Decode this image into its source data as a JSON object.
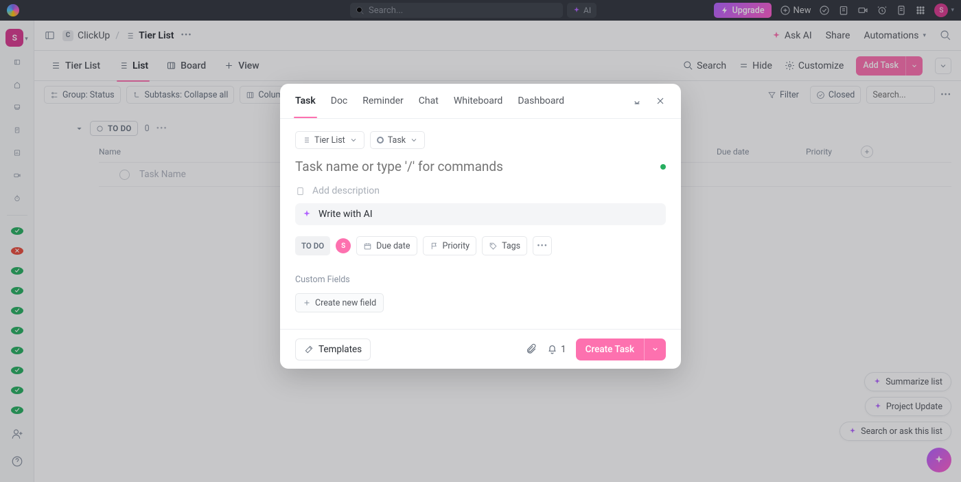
{
  "topbar": {
    "search_placeholder": "Search...",
    "ai_label": "AI",
    "upgrade_label": "Upgrade",
    "new_label": "New",
    "avatar_initial": "S"
  },
  "breadcrumb": {
    "workspace_initial": "C",
    "workspace_label": "ClickUp",
    "list_label": "Tier List",
    "ask_ai_label": "Ask AI",
    "share_label": "Share",
    "automations_label": "Automations"
  },
  "view_tabs": {
    "tier_list": "Tier List",
    "list": "List",
    "board": "Board",
    "view": "View",
    "search": "Search",
    "hide": "Hide",
    "customize": "Customize",
    "add_task": "Add Task"
  },
  "toolbar": {
    "group": "Group: Status",
    "subtasks": "Subtasks: Collapse all",
    "columns": "Columns",
    "filter": "Filter",
    "closed": "Closed",
    "search_placeholder": "Search..."
  },
  "group_header": {
    "status": "TO DO",
    "count": "0"
  },
  "columns": {
    "name": "Name",
    "due_date": "Due date",
    "priority": "Priority"
  },
  "task_row": {
    "placeholder": "Task Name"
  },
  "ai_pills": {
    "summarize": "Summarize list",
    "project_update": "Project Update",
    "search_ask": "Search or ask this list"
  },
  "sidebar": {
    "user_initial": "S"
  },
  "modal": {
    "tabs": {
      "task": "Task",
      "doc": "Doc",
      "reminder": "Reminder",
      "chat": "Chat",
      "whiteboard": "Whiteboard",
      "dashboard": "Dashboard"
    },
    "crumb_list": "Tier List",
    "crumb_type": "Task",
    "title_placeholder": "Task name or type '/' for commands",
    "desc_placeholder": "Add description",
    "write_ai": "Write with AI",
    "chips": {
      "todo": "TO DO",
      "assignee_initial": "S",
      "due_date": "Due date",
      "priority": "Priority",
      "tags": "Tags"
    },
    "custom_fields_label": "Custom Fields",
    "create_field_label": "Create new field",
    "templates_label": "Templates",
    "bell_count": "1",
    "create_task_label": "Create Task"
  }
}
